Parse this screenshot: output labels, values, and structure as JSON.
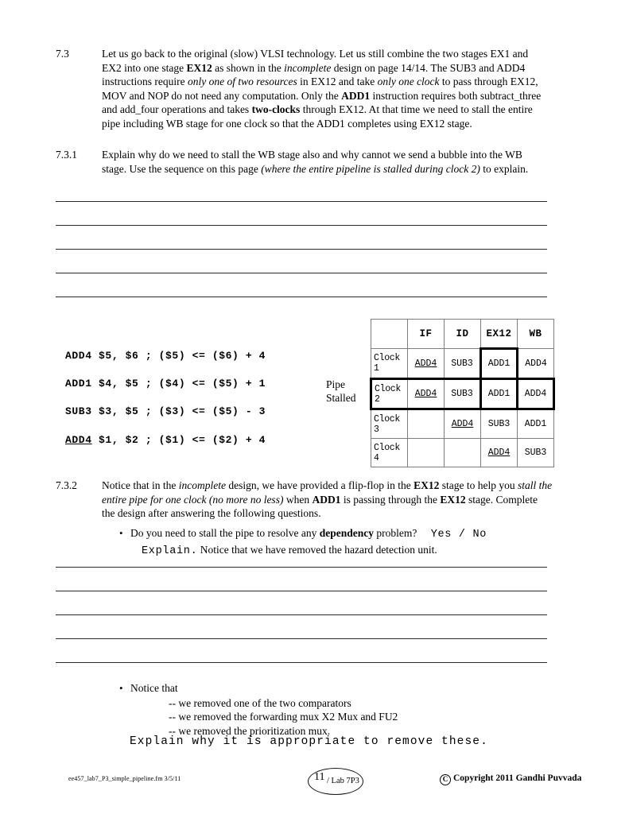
{
  "document": {
    "title": "ee457 Lab 7P3 — Simple Pipeline, page 11"
  },
  "q73": {
    "number": "7.3",
    "text_parts": [
      {
        "t": "Let us go back to the original (slow) VLSI technology. Let us still combine the two stages EX1 and EX2 into one stage ",
        "s": "n"
      },
      {
        "t": "EX12",
        "s": "b"
      },
      {
        "t": " as shown in the ",
        "s": "n"
      },
      {
        "t": "incomplete",
        "s": "i"
      },
      {
        "t": " design on page 14/14. The SUB3 and ADD4 instructions require ",
        "s": "n"
      },
      {
        "t": "only one of two resources",
        "s": "i"
      },
      {
        "t": " in EX12 and take ",
        "s": "n"
      },
      {
        "t": "only one clock",
        "s": "i"
      },
      {
        "t": " to pass through EX12, MOV and NOP do not need any computation. Only the ",
        "s": "n"
      },
      {
        "t": "ADD1",
        "s": "b"
      },
      {
        "t": " instruction requires both subtract_three and add_four operations and takes ",
        "s": "n"
      },
      {
        "t": "two-clocks",
        "s": "b"
      },
      {
        "t": " through EX12. At that time we need to stall the entire pipe including WB stage for one clock so that the ADD1 completes using EX12 stage.",
        "s": "n"
      }
    ]
  },
  "q731": {
    "number": "7.3.1",
    "text_parts": [
      {
        "t": "Explain why do we need to stall the WB stage also and why cannot we send a bubble into the WB stage. Use the sequence on this page  ",
        "s": "n"
      },
      {
        "t": "(where the entire pipeline is stalled during clock 2)",
        "s": "i"
      },
      {
        "t": " to explain.",
        "s": "n"
      }
    ]
  },
  "answer_lines_top": {
    "count": 5,
    "offsets": [
      0,
      30,
      60,
      90,
      120
    ]
  },
  "answer_lines_bottom": {
    "count": 5,
    "offsets": [
      0,
      30,
      60,
      90,
      120
    ]
  },
  "code_listing": {
    "lines": [
      {
        "mnemonic": "ADD4",
        "underline": false,
        "rest": " $5, $6 ; ($5) <= ($6) + 4"
      },
      {
        "mnemonic": "ADD1",
        "underline": false,
        "rest": " $4, $5 ; ($4) <= ($5) + 1"
      },
      {
        "mnemonic": "SUB3",
        "underline": false,
        "rest": " $3, $5 ; ($3) <= ($5) - 3"
      },
      {
        "mnemonic": "ADD4",
        "underline": true,
        "rest": " $1, $2 ; ($1) <= ($2) + 4"
      }
    ]
  },
  "pipe_stalled_label": {
    "line1": "Pipe",
    "line2": "Stalled"
  },
  "pipeline_table": {
    "corner": "",
    "headers": [
      "IF",
      "ID",
      "EX12",
      "WB"
    ],
    "rows": [
      {
        "label": "Clock 1",
        "cells": [
          {
            "text": "ADD4",
            "underline": true
          },
          {
            "text": "SUB3",
            "underline": false
          },
          {
            "text": "ADD1",
            "underline": false
          },
          {
            "text": "ADD4",
            "underline": false
          }
        ]
      },
      {
        "label": "Clock 2",
        "cells": [
          {
            "text": "ADD4",
            "underline": true
          },
          {
            "text": "SUB3",
            "underline": false
          },
          {
            "text": "ADD1",
            "underline": false
          },
          {
            "text": "ADD4",
            "underline": false
          }
        ]
      },
      {
        "label": "Clock 3",
        "cells": [
          {
            "text": "",
            "underline": false
          },
          {
            "text": "ADD4",
            "underline": true
          },
          {
            "text": "SUB3",
            "underline": false
          },
          {
            "text": "ADD1",
            "underline": false
          }
        ]
      },
      {
        "label": "Clock 4",
        "cells": [
          {
            "text": "",
            "underline": false
          },
          {
            "text": "",
            "underline": false
          },
          {
            "text": "ADD4",
            "underline": true
          },
          {
            "text": "SUB3",
            "underline": false
          }
        ]
      }
    ],
    "emphasis": {
      "stalled_row_label": "Clock 2",
      "stalled_column": "EX12",
      "border_color": "#000000"
    }
  },
  "q732": {
    "number": "7.3.2",
    "text_parts": [
      {
        "t": "Notice that in the ",
        "s": "n"
      },
      {
        "t": "incomplete",
        "s": "i"
      },
      {
        "t": " design, we have provided a flip-flop in the ",
        "s": "n"
      },
      {
        "t": "EX12",
        "s": "b"
      },
      {
        "t": " stage to help you ",
        "s": "n"
      },
      {
        "t": "stall the entire pipe for one clock (no more no less)",
        "s": "i"
      },
      {
        "t": " when ",
        "s": "n"
      },
      {
        "t": "ADD1",
        "s": "b"
      },
      {
        "t": " is passing through the ",
        "s": "n"
      },
      {
        "t": "EX12",
        "s": "b"
      },
      {
        "t": " stage. Complete the design after answering the following questions.",
        "s": "n"
      }
    ]
  },
  "bullet_dependency": {
    "marker": "•",
    "line1_parts": [
      {
        "t": "Do you need to stall the pipe to resolve any ",
        "s": "n"
      },
      {
        "t": "dependency",
        "s": "b"
      },
      {
        "t": " problem?",
        "s": "n"
      }
    ],
    "choice": "Yes / No",
    "line2_mono": "Explain.",
    "line2_rest": " Notice that we have removed the hazard detection unit."
  },
  "bullet_notice": {
    "marker": "•",
    "heading": "Notice that",
    "sub_items": [
      "-- we removed one of the two comparators",
      "-- we removed the forwarding mux X2  Mux and FU2",
      "-- we removed the prioritization mux."
    ],
    "explain_line": "Explain why it is appropriate to remove these."
  },
  "footer": {
    "file_name": "ee457_lab7_P3_simple_pipeline.fm  3/5/11",
    "page_number": "11",
    "page_label": "/ Lab 7P3",
    "copyright_symbol": "C",
    "copyright_text": "Copyright 2011 Gandhi Puvvada"
  }
}
